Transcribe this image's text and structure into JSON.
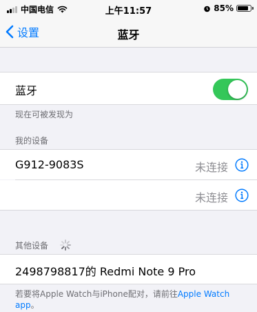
{
  "status_bar": {
    "carrier": "中国电信",
    "time": "上午11:57",
    "battery": "85%",
    "battery_level": 0.85
  },
  "nav": {
    "back_label": "设置",
    "title": "蓝牙"
  },
  "bluetooth": {
    "label": "蓝牙",
    "enabled": true
  },
  "discoverable_note": "现在可被发现为",
  "my_devices": {
    "header": "我的设备",
    "items": [
      {
        "name": "G912-9083S",
        "status": "未连接"
      },
      {
        "name": "",
        "status": "未连接"
      }
    ]
  },
  "other_devices": {
    "header": "其他设备",
    "items": [
      {
        "name": "2498798817的 Redmi Note 9 Pro"
      }
    ]
  },
  "footer": {
    "text": "若要将Apple Watch与iPhone配对，请前往",
    "link": "Apple Watch app",
    "end": "。"
  },
  "colors": {
    "accent": "#007aff",
    "toggle_on": "#34c759",
    "background": "#f2f2f7"
  }
}
